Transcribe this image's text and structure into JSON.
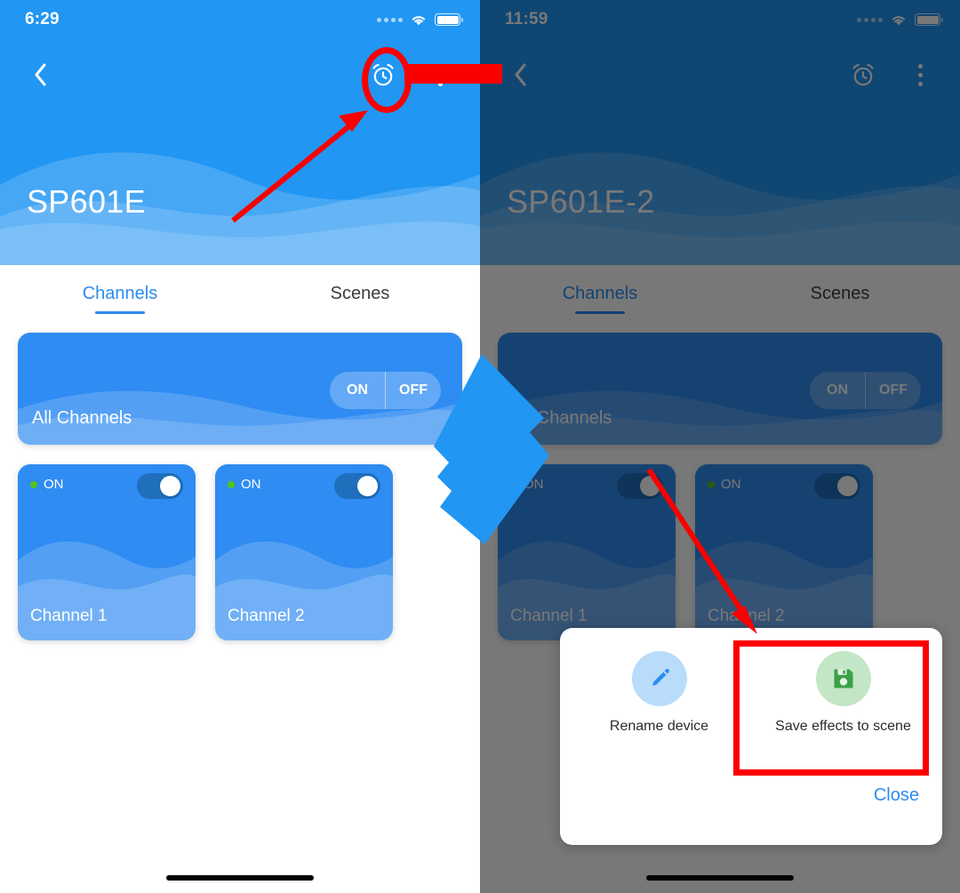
{
  "screens": [
    {
      "id": "left",
      "status": {
        "time": "6:29",
        "signal_dots": 4,
        "wifi": "wifi-icon",
        "battery": "battery-full-icon"
      },
      "nav": {
        "back": "chevron-left-icon",
        "alarm": "alarm-clock-icon",
        "more": "overflow-menu-icon"
      },
      "hero": {
        "title": "SP601E"
      },
      "tabs": [
        {
          "label": "Channels",
          "active": true
        },
        {
          "label": "Scenes",
          "active": false
        }
      ],
      "all_channels": {
        "label": "All Channels",
        "on_label": "ON",
        "off_label": "OFF"
      },
      "channels": [
        {
          "name": "Channel 1",
          "state": "ON",
          "toggle": "on"
        },
        {
          "name": "Channel 2",
          "state": "ON",
          "toggle": "on"
        }
      ],
      "dimmed": false
    },
    {
      "id": "right",
      "status": {
        "time": "11:59",
        "signal_dots": 4,
        "wifi": "wifi-icon",
        "battery": "battery-full-icon"
      },
      "nav": {
        "back": "chevron-left-icon",
        "alarm": "alarm-clock-icon",
        "more": "overflow-menu-icon"
      },
      "hero": {
        "title": "SP601E-2"
      },
      "tabs": [
        {
          "label": "Channels",
          "active": true
        },
        {
          "label": "Scenes",
          "active": false
        }
      ],
      "all_channels": {
        "label": "All Channels",
        "on_label": "ON",
        "off_label": "OFF"
      },
      "channels": [
        {
          "name": "Channel 1",
          "state": "ON",
          "toggle": "on"
        },
        {
          "name": "Channel 2",
          "state": "ON",
          "toggle": "on"
        }
      ],
      "dimmed": true
    }
  ],
  "modal": {
    "actions": [
      {
        "label": "Rename device",
        "icon": "pencil-icon",
        "circle_color": "#b9dcfb",
        "icon_color": "#2d8cf0"
      },
      {
        "label": "Save effects to scene",
        "icon": "floppy-save-icon",
        "circle_color": "#c3e6c6",
        "icon_color": "#3ba049"
      }
    ],
    "close_label": "Close"
  },
  "annotations": {
    "highlight_color": "#fb0000",
    "ellipse_target": "overflow-menu-icon",
    "arrow_left_target": "overflow-menu-icon",
    "arrow_right_target": "save-effects-to-scene-action",
    "rect_target": "save-effects-to-scene-action",
    "transition_arrow": "step-transition-arrow"
  },
  "theme": {
    "brand_blue": "#2196f3",
    "card_blue": "#2f8cf2",
    "accent_blue": "#2d8cf0",
    "status_green": "#52c41a",
    "save_green": "#3ba049",
    "dim": "rgba(0,0,0,0.53)"
  }
}
